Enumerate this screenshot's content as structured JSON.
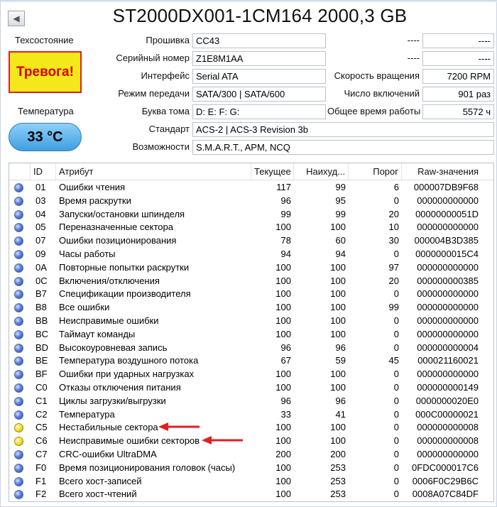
{
  "title": "ST2000DX001-1CM164 2000,3 GB",
  "health_label": "Техсостояние",
  "health_status": "Тревога!",
  "temperature_label": "Температура",
  "temperature_value": "33 °C",
  "fields_left": [
    {
      "label": "Прошивка",
      "value": "CC43"
    },
    {
      "label": "Серийный номер",
      "value": "Z1E8M1AA"
    },
    {
      "label": "Интерфейс",
      "value": "Serial ATA"
    },
    {
      "label": "Режим передачи",
      "value": "SATA/300 | SATA/600"
    },
    {
      "label": "Буква тома",
      "value": "D: E: F: G:"
    },
    {
      "label": "Стандарт",
      "value": "ACS-2 | ACS-3 Revision 3b"
    },
    {
      "label": "Возможности",
      "value": "S.M.A.R.T., APM, NCQ"
    }
  ],
  "fields_right": [
    {
      "label": "----",
      "value": "----"
    },
    {
      "label": "----",
      "value": "----"
    },
    {
      "label": "Скорость вращения",
      "value": "7200 RPM"
    },
    {
      "label": "Число включений",
      "value": "901 раз"
    },
    {
      "label": "Общее время работы",
      "value": "5572 ч"
    }
  ],
  "columns": {
    "id": "ID",
    "attribute": "Атрибут",
    "current": "Текущее",
    "worst": "Наихуд...",
    "threshold": "Порог",
    "raw": "Raw-значения"
  },
  "rows": [
    {
      "status": "good",
      "id": "01",
      "attribute": "Ошибки чтения",
      "current": "117",
      "worst": "99",
      "threshold": "6",
      "raw": "000007DB9F68"
    },
    {
      "status": "good",
      "id": "03",
      "attribute": "Время раскрутки",
      "current": "96",
      "worst": "95",
      "threshold": "0",
      "raw": "000000000000"
    },
    {
      "status": "good",
      "id": "04",
      "attribute": "Запуски/остановки шпинделя",
      "current": "99",
      "worst": "99",
      "threshold": "20",
      "raw": "00000000051D"
    },
    {
      "status": "good",
      "id": "05",
      "attribute": "Переназначенные сектора",
      "current": "100",
      "worst": "100",
      "threshold": "10",
      "raw": "000000000000"
    },
    {
      "status": "good",
      "id": "07",
      "attribute": "Ошибки позиционирования",
      "current": "78",
      "worst": "60",
      "threshold": "30",
      "raw": "000004B3D385"
    },
    {
      "status": "good",
      "id": "09",
      "attribute": "Часы работы",
      "current": "94",
      "worst": "94",
      "threshold": "0",
      "raw": "0000000015C4"
    },
    {
      "status": "good",
      "id": "0A",
      "attribute": "Повторные попытки раскрутки",
      "current": "100",
      "worst": "100",
      "threshold": "97",
      "raw": "000000000000"
    },
    {
      "status": "good",
      "id": "0C",
      "attribute": "Включения/отключения",
      "current": "100",
      "worst": "100",
      "threshold": "20",
      "raw": "000000000385"
    },
    {
      "status": "good",
      "id": "B7",
      "attribute": "Спецификации производителя",
      "current": "100",
      "worst": "100",
      "threshold": "0",
      "raw": "000000000000"
    },
    {
      "status": "good",
      "id": "B8",
      "attribute": "Все ошибки",
      "current": "100",
      "worst": "100",
      "threshold": "99",
      "raw": "000000000000"
    },
    {
      "status": "good",
      "id": "BB",
      "attribute": "Неисправимые ошибки",
      "current": "100",
      "worst": "100",
      "threshold": "0",
      "raw": "000000000000"
    },
    {
      "status": "good",
      "id": "BC",
      "attribute": "Таймаут команды",
      "current": "100",
      "worst": "100",
      "threshold": "0",
      "raw": "000000000000"
    },
    {
      "status": "good",
      "id": "BD",
      "attribute": "Высокоуровневая запись",
      "current": "96",
      "worst": "96",
      "threshold": "0",
      "raw": "000000000004"
    },
    {
      "status": "good",
      "id": "BE",
      "attribute": "Температура воздушного потока",
      "current": "67",
      "worst": "59",
      "threshold": "45",
      "raw": "000021160021"
    },
    {
      "status": "good",
      "id": "BF",
      "attribute": "Ошибки при ударных нагрузках",
      "current": "100",
      "worst": "100",
      "threshold": "0",
      "raw": "000000000000"
    },
    {
      "status": "good",
      "id": "C0",
      "attribute": "Отказы отключения питания",
      "current": "100",
      "worst": "100",
      "threshold": "0",
      "raw": "000000000149"
    },
    {
      "status": "good",
      "id": "C1",
      "attribute": "Циклы загрузки/выгрузки",
      "current": "96",
      "worst": "96",
      "threshold": "0",
      "raw": "0000000020E0"
    },
    {
      "status": "good",
      "id": "C2",
      "attribute": "Температура",
      "current": "33",
      "worst": "41",
      "threshold": "0",
      "raw": "000C00000021"
    },
    {
      "status": "warning",
      "id": "C5",
      "attribute": "Нестабильные сектора",
      "current": "100",
      "worst": "100",
      "threshold": "0",
      "raw": "000000000008"
    },
    {
      "status": "warning",
      "id": "C6",
      "attribute": "Неисправимые ошибки секторов",
      "current": "100",
      "worst": "100",
      "threshold": "0",
      "raw": "000000000008"
    },
    {
      "status": "good",
      "id": "C7",
      "attribute": "CRC-ошибки UltraDMA",
      "current": "200",
      "worst": "200",
      "threshold": "0",
      "raw": "000000000000"
    },
    {
      "status": "good",
      "id": "F0",
      "attribute": "Время позиционирования головок (часы)",
      "current": "100",
      "worst": "253",
      "threshold": "0",
      "raw": "0FDC000017C6"
    },
    {
      "status": "good",
      "id": "F1",
      "attribute": "Всего хост-записей",
      "current": "100",
      "worst": "253",
      "threshold": "0",
      "raw": "0006F0C29B6C"
    },
    {
      "status": "good",
      "id": "F2",
      "attribute": "Всего хост-чтений",
      "current": "100",
      "worst": "253",
      "threshold": "0",
      "raw": "0008A07C84DF"
    }
  ],
  "colors": {
    "alarm_bg": "#f4e81a",
    "alarm_border": "#e02020",
    "alarm_text": "#d00000",
    "temp_bg": "#3e9fe0",
    "status_good": "#2448b8",
    "status_warning": "#f3e030",
    "arrow": "#e02020"
  },
  "icons": {
    "back": "left-triangle",
    "status_good": "blue-circle",
    "status_warning": "yellow-circle",
    "annotation": "red-arrow"
  }
}
